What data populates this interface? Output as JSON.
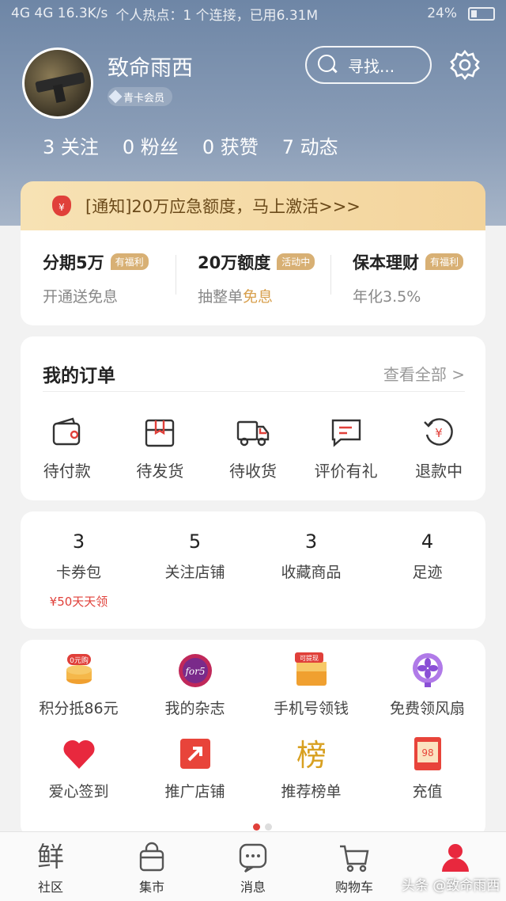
{
  "status_bar": {
    "left": "4G 4G 16.3K/s",
    "hotspot": "个人热点：1 个连接，已用6.31M",
    "battery": "24%"
  },
  "profile": {
    "name": "致命雨西",
    "badge": "青卡会员",
    "search_placeholder": "寻找...",
    "stats": [
      "3 关注",
      "0 粉丝",
      "0 获赞",
      "7 动态"
    ]
  },
  "notice": {
    "icon": "money-bag-icon",
    "text": "[通知]20万应急额度，马上激活>>>"
  },
  "finance": [
    {
      "title": "分期5万",
      "tag": "有福利",
      "sub": "开通送免息",
      "highlight": ""
    },
    {
      "title": "20万额度",
      "tag": "活动中",
      "sub": "抽整单",
      "highlight": "免息"
    },
    {
      "title": "保本理财",
      "tag": "有福利",
      "sub": "年化3.5%",
      "highlight": ""
    }
  ],
  "orders": {
    "title": "我的订单",
    "view_all": "查看全部 >",
    "items": [
      "待付款",
      "待发货",
      "待收货",
      "评价有礼",
      "退款中"
    ]
  },
  "assets": [
    {
      "count": "3",
      "label": "卡券包",
      "sub": "¥50天天领"
    },
    {
      "count": "5",
      "label": "关注店铺",
      "sub": ""
    },
    {
      "count": "3",
      "label": "收藏商品",
      "sub": ""
    },
    {
      "count": "4",
      "label": "足迹",
      "sub": ""
    }
  ],
  "tools": [
    {
      "label": "积分抵86元",
      "icon_text": "0元购"
    },
    {
      "label": "我的杂志",
      "icon_text": "for5"
    },
    {
      "label": "手机号领钱",
      "icon_text": "可提现"
    },
    {
      "label": "免费领风扇",
      "icon_text": ""
    },
    {
      "label": "爱心签到",
      "icon_text": ""
    },
    {
      "label": "推广店铺",
      "icon_text": ""
    },
    {
      "label": "推荐榜单",
      "icon_text": "榜"
    },
    {
      "label": "充值",
      "icon_text": "98"
    }
  ],
  "tabbar": [
    {
      "label": "社区",
      "glyph": "鲜"
    },
    {
      "label": "集市"
    },
    {
      "label": "消息"
    },
    {
      "label": "购物车"
    },
    {
      "label": ""
    }
  ],
  "watermark": "头条 @致命雨西",
  "colors": {
    "accent": "#e0403a",
    "header": "#8a9db7",
    "gold": "#d8b074"
  }
}
